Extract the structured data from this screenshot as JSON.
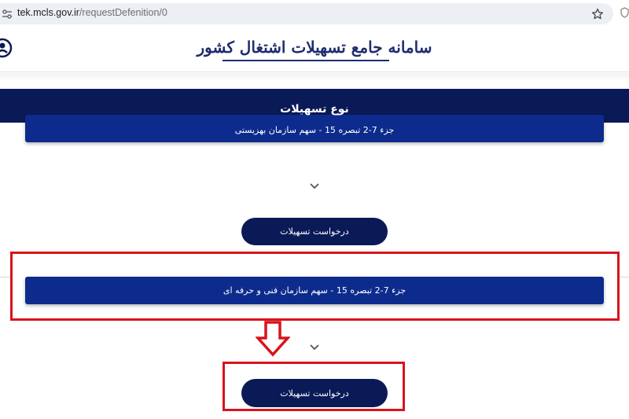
{
  "browser": {
    "url_host": "tek.mcls.gov.ir",
    "url_path": "/requestDefenition/0"
  },
  "header": {
    "site_title": "سامانه جامع تسهیلات اشتغال کشور"
  },
  "page": {
    "type_title": "نوع تسهیلات"
  },
  "facilities": [
    {
      "label": "جزء 7-2 تبصره 15 - سهم سازمان بهزیستی",
      "request_label": "درخواست تسهیلات"
    },
    {
      "label": "جزء 7-2 تبصره 15 - سهم سازمان فنی و حرفه ای",
      "request_label": "درخواست تسهیلات"
    }
  ],
  "colors": {
    "banner": "#0a1a56",
    "facility_bar": "#0d2b8c",
    "highlight": "#d8131c",
    "title_text": "#1f2c6f"
  },
  "icons": {
    "site_info": "tune-icon",
    "bookmark": "star-icon",
    "extension": "shield-icon",
    "account": "user-icon",
    "expand": "chevron-down-icon",
    "annotation": "arrow-down-icon"
  }
}
